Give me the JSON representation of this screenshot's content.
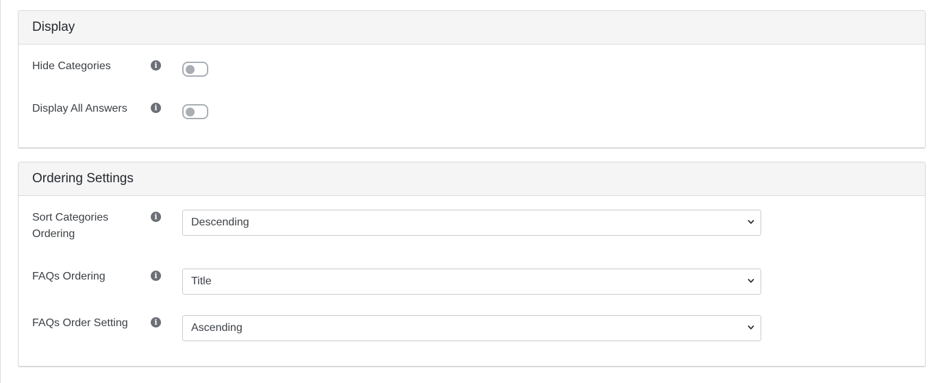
{
  "display": {
    "title": "Display",
    "fields": [
      {
        "label": "Hide Categories",
        "info_icon": "info-circle-icon",
        "toggle_on": false
      },
      {
        "label": "Display All Answers",
        "info_icon": "info-circle-icon",
        "toggle_on": false
      }
    ]
  },
  "ordering": {
    "title": "Ordering Settings",
    "fields": [
      {
        "label": "Sort Categories Ordering",
        "info_icon": "info-circle-icon",
        "selected": "Descending"
      },
      {
        "label": "FAQs Ordering",
        "info_icon": "info-circle-icon",
        "selected": "Title"
      },
      {
        "label": "FAQs Order Setting",
        "info_icon": "info-circle-icon",
        "selected": "Ascending"
      }
    ]
  },
  "info_glyph": "i",
  "colors": {
    "header_bg": "#f5f5f5",
    "border": "#d6d8db",
    "toggle_off": "#a9aeb4",
    "icon": "#6c7076",
    "text": "#3b3f44"
  }
}
